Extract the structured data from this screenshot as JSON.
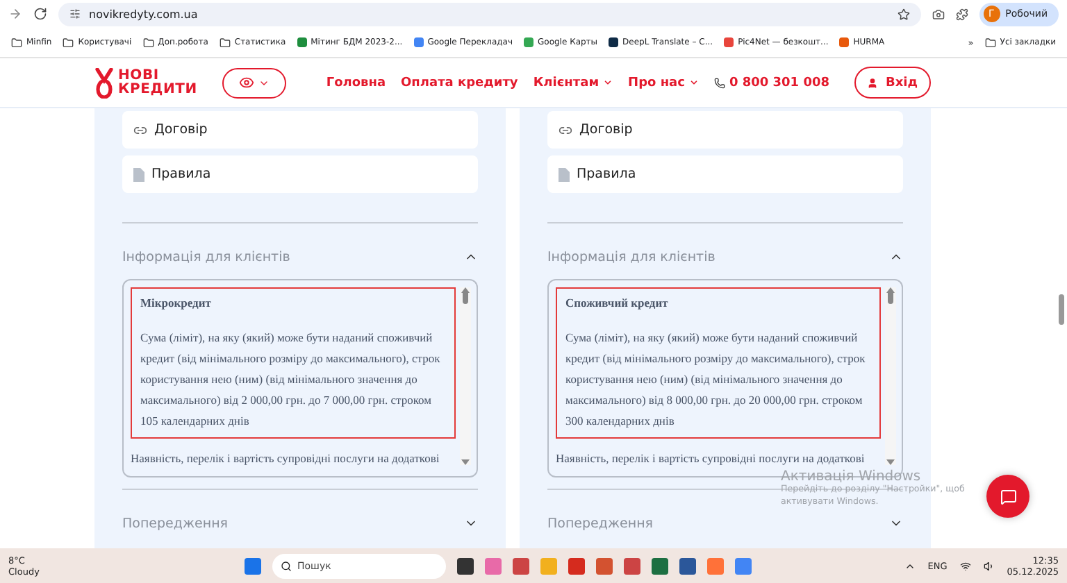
{
  "browser": {
    "url": "novikredyty.com.ua",
    "profile": "Робочий",
    "profile_initial": "Г",
    "bookmarks": [
      {
        "kind": "folder",
        "label": "Minfin"
      },
      {
        "kind": "folder",
        "label": "Користувачі"
      },
      {
        "kind": "folder",
        "label": "Доп.робота"
      },
      {
        "kind": "folder",
        "label": "Статистика"
      },
      {
        "kind": "site",
        "label": "Мітинг БДМ 2023-2...",
        "color": "#1e8e3e"
      },
      {
        "kind": "site",
        "label": "Google Перекладач",
        "color": "#4285f4"
      },
      {
        "kind": "site",
        "label": "Google Карты",
        "color": "#34a853"
      },
      {
        "kind": "site",
        "label": "DeepL Translate – C...",
        "color": "#0f2b46"
      },
      {
        "kind": "site",
        "label": "Pic4Net — безкошт...",
        "color": "#e8453c"
      },
      {
        "kind": "site",
        "label": "HURMA",
        "color": "#e8590c"
      }
    ],
    "overflow": "»",
    "all_bookmarks": "Усі закладки"
  },
  "header": {
    "logo": [
      "НОВІ",
      "КРЕДИТИ"
    ],
    "nav": [
      {
        "label": "Головна",
        "dropdown": false
      },
      {
        "label": "Оплата кредиту",
        "dropdown": false
      },
      {
        "label": "Клієнтам",
        "dropdown": true
      },
      {
        "label": "Про нас",
        "dropdown": true
      }
    ],
    "phone": "0 800 301 008",
    "login": "Вхід"
  },
  "columns": [
    {
      "links": [
        {
          "kind": "link",
          "label": "Договір"
        },
        {
          "kind": "doc",
          "label": "Правила"
        }
      ],
      "sections": [
        {
          "title": "Інформація для клієнтів",
          "expanded": true,
          "heading": "Мікрокредит",
          "body": "Сума (ліміт), на яку (який) може бути наданий споживчий кредит (від мінімального розміру до максимального), строк користування нею (ним) (від мінімального значення до максимального) від 2 000,00 грн. до 7 000,00 грн. строком 105 календарних днів",
          "more": "Наявність, перелік і вартість супровідні послуги на додаткові"
        },
        {
          "title": "Попередження",
          "expanded": false
        }
      ]
    },
    {
      "links": [
        {
          "kind": "link",
          "label": "Договір"
        },
        {
          "kind": "doc",
          "label": "Правила"
        }
      ],
      "sections": [
        {
          "title": "Інформація для клієнтів",
          "expanded": true,
          "heading": "Споживчий кредит",
          "body": "Сума (ліміт), на яку (який) може бути наданий споживчий кредит (від мінімального розміру до максимального), строк користування нею (ним) (від мінімального значення до максимального) від 8 000,00 грн. до 20 000,00 грн. строком 300 календарних днів",
          "more": "Наявність, перелік і вартість супровідні послуги на додаткові"
        },
        {
          "title": "Попередження",
          "expanded": false
        }
      ]
    }
  ],
  "activation": {
    "title": "Активація Windows",
    "text": "Перейдіть до розділу \"Настройки\", щоб активувати Windows."
  },
  "taskbar": {
    "temperature": "8°C",
    "weather": "Cloudy",
    "search_placeholder": "Пошук",
    "language": "ENG",
    "time": "12:35",
    "date": "05.12.2025"
  }
}
